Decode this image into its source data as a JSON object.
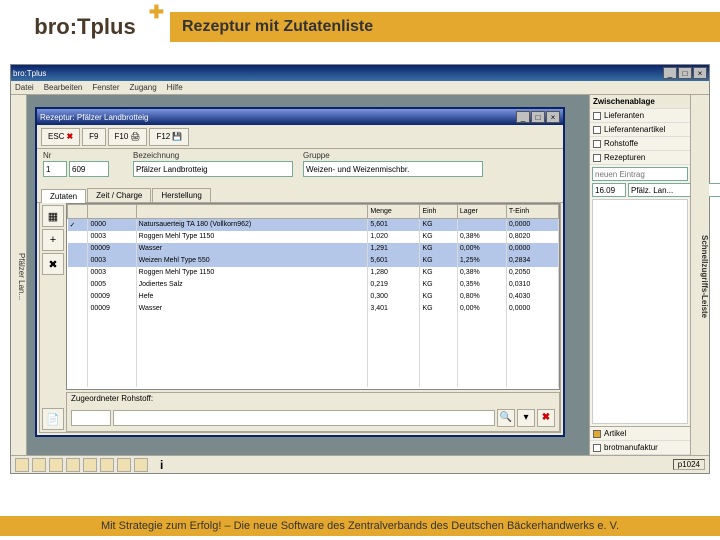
{
  "brand": "bro:Tplus",
  "slide_title": "Rezeptur mit Zutatenliste",
  "footer": "Mit Strategie zum Erfolg! – Die neue Software des Zentralverbands des Deutschen Bäckerhandwerks e. V.",
  "app": {
    "title": "bro:Tplus",
    "menus": [
      "Datei",
      "Bearbeiten",
      "Fenster",
      "Zugang",
      "Hilfe"
    ],
    "left_rail": "Pfälzer Lan...",
    "status_right": "p1024"
  },
  "right_panel": {
    "header": "Zwischenablage",
    "rail": "Schnellzugriffs-Leiste",
    "items": [
      "Lieferanten",
      "Lieferantenartikel",
      "Rohstoffe",
      "Rezepturen"
    ],
    "search_ph": "neuen Eintrag",
    "code": "16.09",
    "code_text": "Pfälz. Lan...",
    "bottom_items": [
      "Artikel",
      "brotmanufaktur"
    ]
  },
  "inner": {
    "title": "Rezeptur: Pfälzer Landbrotteig",
    "toolbar": {
      "esc": "ESC",
      "f9": "F9",
      "f10": "F10",
      "f12": "F12"
    },
    "form": {
      "nr_label": "Nr",
      "nr_value": "1",
      "code_value": "609",
      "bez_label": "Bezeichnung",
      "bez_value": "Pfälzer Landbrotteig",
      "gruppe_label": "Gruppe",
      "gruppe_value": "Weizen- und Weizenmischbr."
    },
    "tabs": [
      "Zutaten",
      "Zeit / Charge",
      "Herstellung"
    ],
    "grid": {
      "cols": [
        "",
        "",
        "",
        "Menge",
        "Einh",
        "Lager",
        "T-Einh"
      ],
      "rows": [
        {
          "sel": true,
          "c": [
            "✓",
            "0000",
            "Natursauerteig TA 180 (Vollkorn962)",
            "5,601",
            "KG",
            "",
            "0,0000"
          ]
        },
        {
          "sel": false,
          "c": [
            "",
            "0003",
            "Roggen Mehl Type 1150",
            "1,020",
            "KG",
            "0,38%",
            "0,8020"
          ]
        },
        {
          "sel": true,
          "c": [
            "",
            "00009",
            "Wasser",
            "1,291",
            "KG",
            "0,00%",
            "0,0000"
          ]
        },
        {
          "sel": true,
          "c": [
            "",
            "0003",
            "Weizen Mehl Type 550",
            "5,601",
            "KG",
            "1,25%",
            "0,2834"
          ]
        },
        {
          "sel": false,
          "c": [
            "",
            "0003",
            "Roggen Mehl Type 1150",
            "1,280",
            "KG",
            "0,38%",
            "0,2050"
          ]
        },
        {
          "sel": false,
          "c": [
            "",
            "0005",
            "Jodiertes Salz",
            "0,219",
            "KG",
            "0,35%",
            "0,0310"
          ]
        },
        {
          "sel": false,
          "c": [
            "",
            "00009",
            "Hefe",
            "0,300",
            "KG",
            "0,80%",
            "0,4030"
          ]
        },
        {
          "sel": false,
          "c": [
            "",
            "00009",
            "Wasser",
            "3,401",
            "KG",
            "0,00%",
            "0,0000"
          ]
        }
      ]
    },
    "bottom_label": "Zugeordneter Rohstoff:"
  }
}
